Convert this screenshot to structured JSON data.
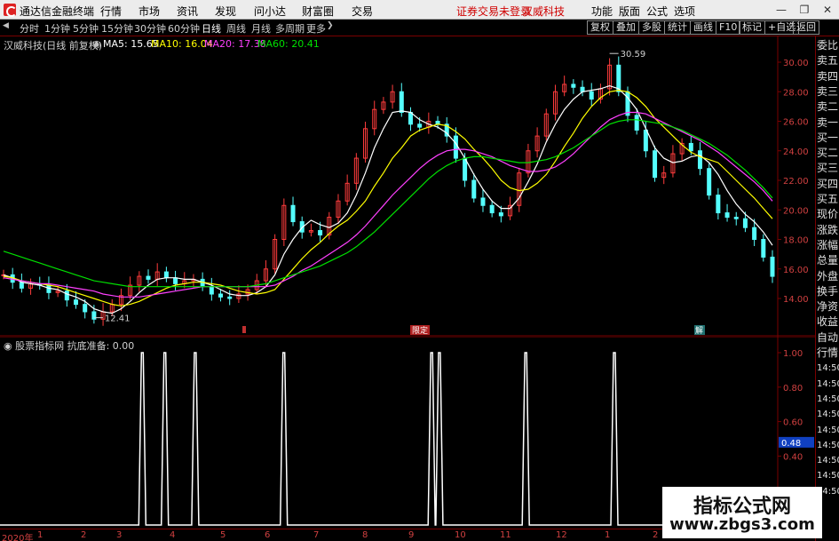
{
  "menubar": {
    "app_title": "通达信金融终端",
    "menus": [
      "行情",
      "市场",
      "资讯",
      "发现",
      "问小达",
      "财富圈",
      "交易"
    ],
    "warning": "证券交易未登录",
    "stock_name": "汉威科技",
    "right_menus": [
      "功能",
      "版面",
      "公式",
      "选项"
    ]
  },
  "toolbar": {
    "periods": [
      "分时",
      "1分钟",
      "5分钟",
      "15分钟",
      "30分钟",
      "60分钟",
      "日线",
      "周线",
      "月线",
      "多周期",
      "更多"
    ],
    "active_period": "日线",
    "right_buttons": [
      "复权",
      "叠加",
      "多股",
      "统计",
      "画线",
      "F10",
      "标记",
      "+自选",
      "返回"
    ]
  },
  "legend": {
    "stock": "汉威科技(日线 前复权)",
    "ma": [
      {
        "label": "MA5: 15.65",
        "color": "#ffffff"
      },
      {
        "label": "MA10: 16.04",
        "color": "#ffff00"
      },
      {
        "label": "MA20: 17.38",
        "color": "#ff40ff"
      },
      {
        "label": "MA60: 20.41",
        "color": "#00e000"
      }
    ]
  },
  "price_axis": [
    "30.00",
    "28.00",
    "26.00",
    "24.00",
    "22.00",
    "20.00",
    "18.00",
    "16.00",
    "14.00"
  ],
  "price_annotations": {
    "high": "30.59",
    "low": "12.41"
  },
  "markers": {
    "m1": "限定",
    "m2": "解"
  },
  "indicator": {
    "legend": "股票指标网 抗底准备: 0.00",
    "axis": [
      "1.00",
      "0.80",
      "0.60",
      "0.48",
      "0.40",
      "0.20"
    ],
    "highlight": "0.48"
  },
  "sidebar": [
    "委比",
    "卖五",
    "卖四",
    "卖三",
    "卖二",
    "卖一",
    "买一",
    "买二",
    "买三",
    "买四",
    "买五",
    "现价",
    "涨跌",
    "涨幅",
    "总量",
    "外盘",
    "换手",
    "净资",
    "收益",
    "自动",
    "行情",
    "14:50",
    "14:50",
    "14:50",
    "14:50",
    "14:50",
    "14:50",
    "14:50",
    "14:50",
    "14:50"
  ],
  "date_axis": [
    "2020年",
    "1",
    "2",
    "3",
    "4",
    "5",
    "6",
    "7",
    "8",
    "9",
    "10",
    "11",
    "12",
    "1",
    "2"
  ],
  "watermark": {
    "line1": "指标公式网",
    "line2": "www.zbgs3.com"
  },
  "colors": {
    "up": "#ff3c3c",
    "down": "#54ffff",
    "grid": "#7a0000",
    "axis_text": "#d04040"
  },
  "chart_data": [
    {
      "type": "line",
      "title": "汉威科技(日线 前复权)",
      "ylim": [
        13.0,
        31.0
      ],
      "y_ticks": [
        14,
        16,
        18,
        20,
        22,
        24,
        26,
        28,
        30
      ],
      "series": [
        {
          "name": "close",
          "color": "#54ffff",
          "values": [
            15.6,
            15.1,
            14.7,
            15.0,
            14.9,
            14.4,
            14.5,
            13.9,
            13.6,
            13.1,
            12.6,
            13.1,
            13.6,
            14.2,
            14.9,
            15.5,
            15.3,
            15.8,
            15.4,
            15.0,
            15.2,
            15.3,
            14.8,
            14.3,
            14.1,
            14.0,
            14.3,
            14.6,
            15.2,
            16.0,
            18.0,
            20.3,
            19.2,
            18.5,
            18.6,
            18.3,
            19.5,
            20.6,
            21.8,
            23.5,
            25.5,
            26.8,
            27.3,
            28.0,
            26.6,
            25.8,
            25.6,
            26.0,
            25.8,
            25.0,
            23.5,
            22.0,
            20.8,
            20.3,
            19.8,
            19.6,
            20.3,
            22.5,
            24.0,
            25.0,
            26.5,
            28.0,
            28.5,
            28.3,
            28.0,
            27.5,
            28.2,
            29.8,
            28.0,
            26.4,
            25.4,
            24.0,
            22.2,
            22.5,
            23.8,
            24.5,
            24.0,
            22.8,
            21.0,
            19.8,
            19.5,
            19.4,
            18.8,
            18.0,
            16.8,
            15.5
          ]
        },
        {
          "name": "MA5",
          "color": "#ffffff",
          "values": [
            15.6,
            15.4,
            15.1,
            15.0,
            14.9,
            14.7,
            14.6,
            14.3,
            14.1,
            13.8,
            13.3,
            13.1,
            13.0,
            13.3,
            13.8,
            14.4,
            14.9,
            15.3,
            15.4,
            15.4,
            15.3,
            15.3,
            15.1,
            14.9,
            14.6,
            14.3,
            14.2,
            14.2,
            14.4,
            14.8,
            15.6,
            17.0,
            18.0,
            18.8,
            19.3,
            19.0,
            18.8,
            19.1,
            19.8,
            21.0,
            22.5,
            24.2,
            25.5,
            26.6,
            26.7,
            26.6,
            26.1,
            25.8,
            25.6,
            25.2,
            24.5,
            23.5,
            22.4,
            21.4,
            20.6,
            20.1,
            20.1,
            20.8,
            21.9,
            23.1,
            24.6,
            25.8,
            26.8,
            27.5,
            28.0,
            28.1,
            28.2,
            28.4,
            28.2,
            27.6,
            26.8,
            25.5,
            24.2,
            23.5,
            23.2,
            23.3,
            23.6,
            23.7,
            23.2,
            22.4,
            21.3,
            20.4,
            19.7,
            19.2,
            18.5,
            17.6
          ]
        },
        {
          "name": "MA10",
          "color": "#ffff00",
          "values": [
            15.5,
            15.4,
            15.2,
            15.1,
            15.0,
            14.9,
            14.8,
            14.6,
            14.4,
            14.2,
            14.0,
            13.8,
            13.6,
            13.5,
            13.6,
            13.8,
            14.1,
            14.4,
            14.7,
            14.9,
            15.0,
            15.1,
            15.1,
            15.0,
            14.9,
            14.7,
            14.5,
            14.4,
            14.3,
            14.4,
            14.6,
            15.3,
            16.0,
            16.7,
            17.3,
            17.8,
            18.4,
            18.9,
            19.3,
            19.9,
            20.6,
            21.6,
            22.5,
            23.5,
            24.2,
            25.0,
            25.4,
            25.6,
            25.8,
            25.7,
            25.3,
            24.8,
            24.1,
            23.5,
            22.8,
            22.0,
            21.5,
            21.3,
            21.4,
            21.8,
            22.4,
            23.3,
            24.3,
            25.2,
            26.2,
            27.0,
            27.6,
            28.0,
            28.1,
            28.0,
            27.6,
            27.0,
            26.2,
            25.6,
            25.0,
            24.4,
            23.9,
            23.6,
            23.4,
            23.2,
            22.6,
            22.0,
            21.4,
            20.8,
            20.1,
            19.4
          ]
        },
        {
          "name": "MA20",
          "color": "#ff40ff",
          "values": [
            15.4,
            15.3,
            15.2,
            15.1,
            15.0,
            15.0,
            14.9,
            14.8,
            14.7,
            14.6,
            14.5,
            14.3,
            14.2,
            14.1,
            14.1,
            14.1,
            14.2,
            14.3,
            14.4,
            14.5,
            14.6,
            14.7,
            14.8,
            14.8,
            14.8,
            14.8,
            14.8,
            14.8,
            14.8,
            14.8,
            14.9,
            15.2,
            15.5,
            15.9,
            16.2,
            16.6,
            17.0,
            17.4,
            17.8,
            18.3,
            18.9,
            19.6,
            20.3,
            21.0,
            21.6,
            22.2,
            22.8,
            23.3,
            23.7,
            24.0,
            24.1,
            24.1,
            24.0,
            23.8,
            23.6,
            23.3,
            23.0,
            22.8,
            22.6,
            22.6,
            22.7,
            22.9,
            23.3,
            23.8,
            24.4,
            25.0,
            25.6,
            26.1,
            26.4,
            26.6,
            26.6,
            26.5,
            26.2,
            25.9,
            25.6,
            25.3,
            25.0,
            24.7,
            24.3,
            23.9,
            23.4,
            22.9,
            22.4,
            21.9,
            21.3,
            20.6
          ]
        },
        {
          "name": "MA60",
          "color": "#00e000",
          "values": [
            17.2,
            17.0,
            16.8,
            16.6,
            16.4,
            16.2,
            16.0,
            15.8,
            15.6,
            15.4,
            15.2,
            15.1,
            15.0,
            14.9,
            14.8,
            14.8,
            14.8,
            14.8,
            14.8,
            14.8,
            14.8,
            14.8,
            14.8,
            14.8,
            14.8,
            14.8,
            14.8,
            14.8,
            14.9,
            15.0,
            15.2,
            15.4,
            15.6,
            15.8,
            16.0,
            16.2,
            16.5,
            16.8,
            17.1,
            17.5,
            18.0,
            18.5,
            19.1,
            19.7,
            20.3,
            20.9,
            21.5,
            22.1,
            22.6,
            23.0,
            23.3,
            23.5,
            23.6,
            23.6,
            23.5,
            23.4,
            23.3,
            23.2,
            23.2,
            23.3,
            23.4,
            23.6,
            23.9,
            24.2,
            24.6,
            25.0,
            25.4,
            25.8,
            26.0,
            26.1,
            26.1,
            26.0,
            25.9,
            25.8,
            25.6,
            25.4,
            25.1,
            24.8,
            24.5,
            24.1,
            23.7,
            23.2,
            22.7,
            22.1,
            21.5,
            20.8
          ]
        }
      ]
    },
    {
      "type": "line",
      "title": "股票指标网 抗底准备: 0.00",
      "ylim": [
        0,
        1.1
      ],
      "y_ticks": [
        1.0,
        0.8,
        0.6,
        0.4,
        0.2
      ],
      "spikes_x_fraction": [
        0.183,
        0.212,
        0.251,
        0.365,
        0.555,
        0.565,
        0.676,
        0.79
      ],
      "series": [
        {
          "name": "抗底准备",
          "color": "#ffffff",
          "values": [
            0.0
          ]
        }
      ]
    }
  ]
}
